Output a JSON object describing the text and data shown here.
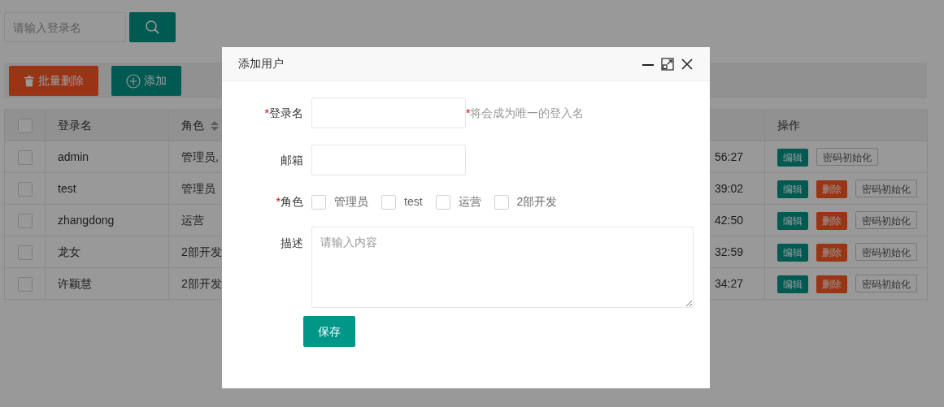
{
  "search": {
    "placeholder": "请输入登录名"
  },
  "toolbar": [
    {
      "label": "批量删除",
      "kind": "danger"
    },
    {
      "label": "添加",
      "kind": "primary"
    }
  ],
  "table": {
    "headers": [
      {
        "kind": "checkbox",
        "checked": false
      },
      {
        "kind": "text",
        "label": "登录名"
      },
      {
        "kind": "sort",
        "label": "角色"
      },
      {
        "kind": "blank"
      },
      {
        "kind": "text",
        "label": "操作"
      }
    ],
    "rows": [
      {
        "checked": false,
        "login": "admin",
        "role": "管理员,",
        "column_4": "56:27",
        "actions": [
          {
            "kind": "edit",
            "label": "编辑"
          },
          {
            "kind": "reset",
            "label": "密码初始化"
          }
        ]
      },
      {
        "checked": false,
        "login": "test",
        "role": "管理员",
        "column_4": "39:02",
        "actions": [
          {
            "kind": "edit",
            "label": "编辑"
          },
          {
            "kind": "delete",
            "label": "删除"
          },
          {
            "kind": "reset",
            "label": "密码初始化"
          }
        ]
      },
      {
        "checked": false,
        "login": "zhangdong",
        "role": "运营",
        "column_4": "42:50",
        "actions": [
          {
            "kind": "edit",
            "label": "编辑"
          },
          {
            "kind": "delete",
            "label": "删除"
          },
          {
            "kind": "reset",
            "label": "密码初始化"
          }
        ]
      },
      {
        "checked": false,
        "login": "龙女",
        "role": "2部开发",
        "column_4": "32:59",
        "actions": [
          {
            "kind": "edit",
            "label": "编辑"
          },
          {
            "kind": "delete",
            "label": "删除"
          },
          {
            "kind": "reset",
            "label": "密码初始化"
          }
        ]
      },
      {
        "checked": false,
        "login": "许颖慧",
        "role": "2部开发",
        "column_4": "34:27",
        "actions": [
          {
            "kind": "edit",
            "label": "编辑"
          },
          {
            "kind": "delete",
            "label": "删除"
          },
          {
            "kind": "reset",
            "label": "密码初始化"
          }
        ]
      }
    ]
  },
  "modal": {
    "title": "添加用户",
    "fields": [
      {
        "kind": "input",
        "mark": "*",
        "label": "登录名",
        "hint_mark": "*",
        "hint": "将会成为唯一的登入名"
      },
      {
        "kind": "input",
        "label": "邮箱"
      },
      {
        "kind": "checkboxes",
        "mark": "*",
        "label": "角色",
        "options": [
          {
            "label": "管理员",
            "checked": false
          },
          {
            "label": "test",
            "checked": false
          },
          {
            "label": "运营",
            "checked": false
          },
          {
            "label": "2部开发",
            "checked": false
          }
        ]
      },
      {
        "kind": "textarea",
        "label": "描述",
        "placeholder": "请输入内容"
      }
    ],
    "submit": "保存"
  }
}
